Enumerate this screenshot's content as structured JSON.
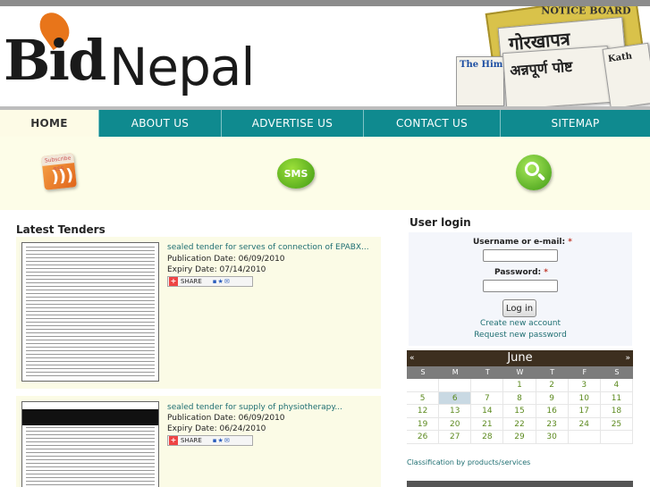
{
  "brand": {
    "logo_text_bid": "Bid",
    "logo_text_nepal": "Nepal",
    "banner": {
      "notice_board": "NOTICE BOARD",
      "paper1": "गोरखापत्र",
      "paper2": "अन्नपूर्ण पोष्ट",
      "paper3": "The Him",
      "paper4": "Kath"
    }
  },
  "nav": {
    "items": [
      {
        "label": "HOME",
        "active": true
      },
      {
        "label": "ABOUT US",
        "active": false
      },
      {
        "label": "ADVERTISE US",
        "active": false
      },
      {
        "label": "CONTACT US",
        "active": false
      },
      {
        "label": "SITEMAP",
        "active": false
      }
    ]
  },
  "icons": {
    "rss": {
      "name": "rss-icon",
      "caption": "Subscribe RSS"
    },
    "sms": {
      "name": "sms-icon",
      "caption": "SMS"
    },
    "search": {
      "name": "search-icon"
    }
  },
  "tenders": {
    "title": "Latest Tenders",
    "items": [
      {
        "link": "sealed tender for serves of connection of EPABX...",
        "publication": "Publication Date: 06/09/2010",
        "expiry": "Expiry Date: 07/14/2010",
        "share_label": "SHARE"
      },
      {
        "link": "sealed tender for supply of physiotherapy...",
        "publication": "Publication Date: 06/09/2010",
        "expiry": "Expiry Date: 06/24/2010",
        "share_label": "SHARE"
      }
    ]
  },
  "login": {
    "title": "User login",
    "username_label": "Username or e-mail:",
    "password_label": "Password:",
    "required_mark": "*",
    "button": "Log in",
    "create_account": "Create new account",
    "request_password": "Request new password"
  },
  "calendar": {
    "month": "June",
    "prev": "«",
    "next": "»",
    "days_of_week": [
      "S",
      "M",
      "T",
      "W",
      "T",
      "F",
      "S"
    ],
    "today": "6",
    "cells": [
      "",
      "",
      "",
      "1",
      "2",
      "3",
      "4",
      "5",
      "6",
      "7",
      "8",
      "9",
      "10",
      "11",
      "12",
      "13",
      "14",
      "15",
      "16",
      "17",
      "18",
      "19",
      "20",
      "21",
      "22",
      "23",
      "24",
      "25",
      "26",
      "27",
      "28",
      "29",
      "30",
      "",
      ""
    ]
  },
  "sidebar": {
    "classification_link": "Classification by products/services"
  },
  "colors": {
    "nav_bg": "#0f8a8f",
    "nav_active_bg": "#fdfbe6",
    "link": "#1f6f72",
    "calendar_header": "#3d2f1f",
    "calendar_day": "#5c8a1f"
  }
}
